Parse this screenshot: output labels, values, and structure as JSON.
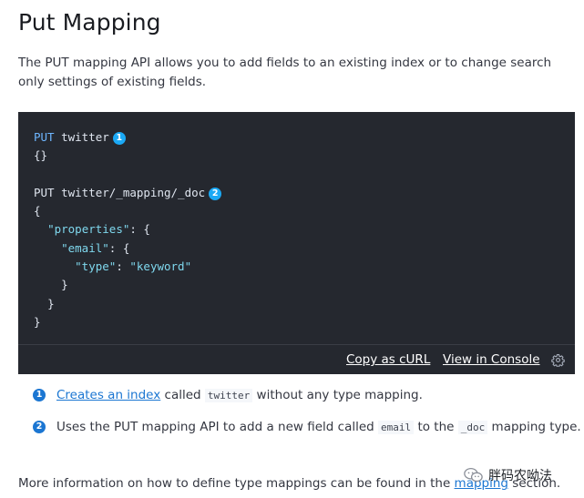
{
  "page": {
    "title": "Put Mapping",
    "intro": "The PUT mapping API allows you to add fields to an existing index or to change search only settings of existing fields."
  },
  "code_block": {
    "lines": {
      "put_method_1": "PUT",
      "put_path_1": " twitter",
      "line_2": "{}",
      "put_line_4": "PUT twitter/_mapping/_doc",
      "line_5": "{",
      "properties_key": "\"properties\"",
      "properties_suffix": ": {",
      "email_key": "\"email\"",
      "email_suffix": ": {",
      "type_key": "\"type\"",
      "type_sep": ": ",
      "type_value": "\"keyword\"",
      "close_3": "}",
      "close_2": "}",
      "close_1": "}"
    },
    "callouts": [
      "1",
      "2"
    ],
    "footer": {
      "copy_curl_label": "Copy as cURL",
      "view_console_label": "View in Console"
    }
  },
  "callout_list": [
    {
      "number": "1",
      "link_text": "Creates an index",
      "text_1": " called ",
      "code": "twitter",
      "text_2": " without any type mapping."
    },
    {
      "number": "2",
      "text_1": "Uses the PUT mapping API to add a new field called ",
      "code_1": "email",
      "text_2": " to the ",
      "code_2": "_doc",
      "text_3": " mapping type."
    }
  ],
  "more_info": {
    "text_before": "More information on how to define type mappings can be found in the ",
    "link_text": "mapping",
    "text_after": " section."
  },
  "watermark": {
    "text": "胖码农呦法"
  },
  "colors": {
    "code_background": "#25282f",
    "callout_blue": "#1ba9f5",
    "link_blue": "#1b76d2",
    "keyword_blue": "#6eb6ff",
    "string_cyan": "#7fd8ee"
  },
  "icons": {
    "settings": "gear-icon",
    "watermark": "wechat-icon"
  }
}
